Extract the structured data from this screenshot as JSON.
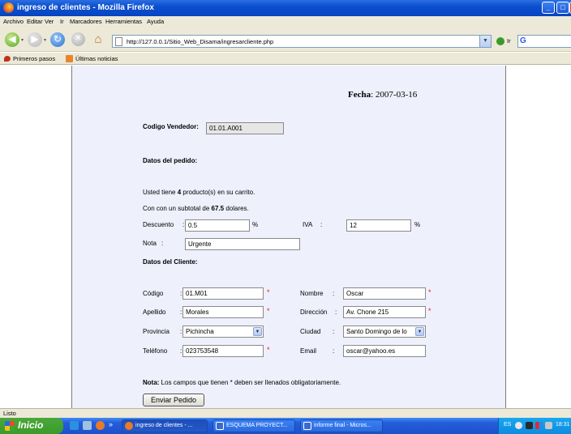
{
  "window": {
    "title": "ingreso de clientes - Mozilla Firefox",
    "min": "_",
    "max": "□",
    "close": "×"
  },
  "menu": [
    "Archivo",
    "Editar",
    "Ver",
    "Ir",
    "Marcadores",
    "Herramientas",
    "Ayuda"
  ],
  "nav": {
    "url": "http://127.0.0.1/Sitio_Web_Disama/ingresarcliente.php",
    "go": "Ir",
    "search_logo": "G"
  },
  "bookmarks": [
    "Primeros pasos",
    "Últimas noticias"
  ],
  "page": {
    "fecha_label": "Fecha",
    "fecha_value": ": 2007-03-16",
    "vendedor_label": "Codigo Vendedor:",
    "vendedor_value": "01.01.A001",
    "pedido_heading": "Datos del pedido:",
    "cart_pre": "Usted tiene ",
    "cart_count": "4",
    "cart_post": " producto(s) en su carrito.",
    "subtotal_pre": "Con con un subtotal de ",
    "subtotal_value": "67.5",
    "subtotal_post": " dolares.",
    "descuento_label": "Descuento",
    "descuento_value": "0.5",
    "pct": "%",
    "iva_label": "IVA",
    "iva_value": "12",
    "nota_label": "Nota",
    "nota_value": "Urgente",
    "cliente_heading": "Datos del Cliente:",
    "colon": ":",
    "codigo_label": "Código",
    "codigo_value": "01.M01",
    "nombre_label": "Nombre",
    "nombre_value": "Oscar",
    "apellido_label": "Apellido",
    "apellido_value": "Morales",
    "direccion_label": "Dirección",
    "direccion_value": "Av. Chone 215",
    "provincia_label": "Provincia",
    "provincia_value": "Pichincha",
    "ciudad_label": "Ciudad",
    "ciudad_value": "Santo Domingo de lo",
    "telefono_label": "Teléfono",
    "telefono_value": "023753548",
    "email_label": "Email",
    "email_value": "oscar@yahoo.es",
    "req": "*",
    "note_bold": "Nota:",
    "note_text": " Los campos que tienen * deben ser llenados obligatoriamente.",
    "submit": "Enviar Pedido"
  },
  "status": "Listo",
  "taskbar": {
    "start": "Inicio",
    "chevron": "»",
    "tasks": [
      "ingreso de clientes - ...",
      "ESQUEMA PROYECT...",
      "informe final - Micros..."
    ],
    "lang": "ES",
    "clock": "18:31"
  }
}
